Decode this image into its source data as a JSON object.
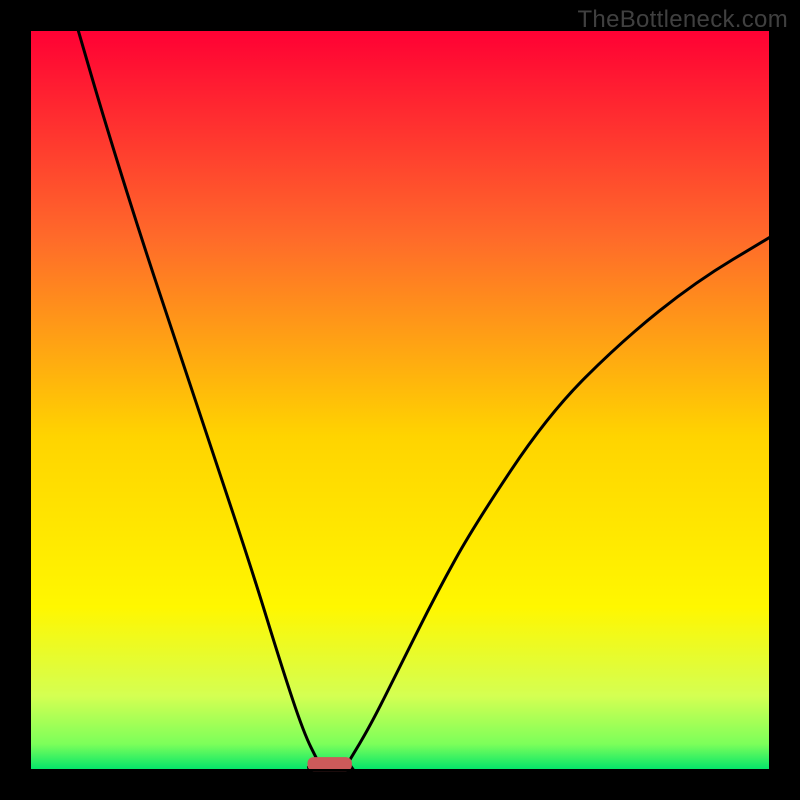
{
  "watermark": "TheBottleneck.com",
  "chart_data": {
    "type": "line",
    "title": "",
    "xlabel": "",
    "ylabel": "",
    "xlim": [
      0,
      100
    ],
    "ylim": [
      0,
      100
    ],
    "background": {
      "type": "vertical-gradient",
      "stops": [
        {
          "offset": 0.0,
          "color": "#ff0034"
        },
        {
          "offset": 0.28,
          "color": "#ff6a2a"
        },
        {
          "offset": 0.55,
          "color": "#ffd400"
        },
        {
          "offset": 0.78,
          "color": "#fff700"
        },
        {
          "offset": 0.9,
          "color": "#d4ff52"
        },
        {
          "offset": 0.965,
          "color": "#7cff5a"
        },
        {
          "offset": 1.0,
          "color": "#00e56a"
        }
      ]
    },
    "curve": {
      "description": "V-shaped bottleneck curve with minimum near x≈40, rising steeply toward both sides",
      "min_x": 40,
      "left_top_y": 100,
      "right_top_y_at_x100": 72,
      "points_left": [
        {
          "x": 6.5,
          "y": 100
        },
        {
          "x": 10,
          "y": 88
        },
        {
          "x": 15,
          "y": 72
        },
        {
          "x": 20,
          "y": 57
        },
        {
          "x": 25,
          "y": 42
        },
        {
          "x": 30,
          "y": 27
        },
        {
          "x": 34,
          "y": 14
        },
        {
          "x": 37,
          "y": 5
        },
        {
          "x": 39,
          "y": 1
        }
      ],
      "points_right": [
        {
          "x": 43,
          "y": 1
        },
        {
          "x": 46,
          "y": 6
        },
        {
          "x": 50,
          "y": 14
        },
        {
          "x": 55,
          "y": 24
        },
        {
          "x": 60,
          "y": 33
        },
        {
          "x": 70,
          "y": 48
        },
        {
          "x": 80,
          "y": 58
        },
        {
          "x": 90,
          "y": 66
        },
        {
          "x": 100,
          "y": 72
        }
      ]
    },
    "marker": {
      "shape": "rounded-bar",
      "x_center": 40.5,
      "width": 6,
      "y": 0.8,
      "color": "#cc5a5a"
    },
    "frame": {
      "outer_border_px": 30,
      "inner_outline_color": "#000000"
    }
  }
}
